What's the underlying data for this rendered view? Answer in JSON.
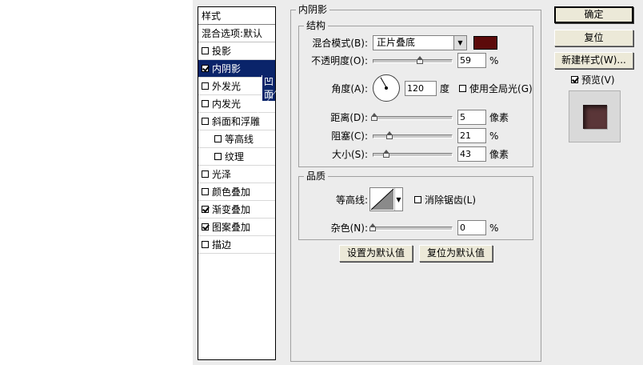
{
  "style_list": {
    "header": "样式",
    "blend_options": "混合选项:默认",
    "items": [
      {
        "label": "投影",
        "checked": false,
        "indent": false
      },
      {
        "label": "内阴影",
        "checked": true,
        "indent": false,
        "selected": true
      },
      {
        "label": "外发光",
        "checked": false,
        "indent": false
      },
      {
        "label": "内发光",
        "checked": false,
        "indent": false
      },
      {
        "label": "斜面和浮雕",
        "checked": false,
        "indent": false
      },
      {
        "label": "等高线",
        "checked": false,
        "indent": true
      },
      {
        "label": "纹理",
        "checked": false,
        "indent": true
      },
      {
        "label": "光泽",
        "checked": false,
        "indent": false
      },
      {
        "label": "颜色叠加",
        "checked": false,
        "indent": false
      },
      {
        "label": "渐变叠加",
        "checked": true,
        "indent": false
      },
      {
        "label": "图案叠加",
        "checked": true,
        "indent": false
      },
      {
        "label": "描边",
        "checked": false,
        "indent": false
      }
    ],
    "tooltip": "凹面"
  },
  "inner_shadow": {
    "title": "内阴影",
    "structure": {
      "title": "结构",
      "blend_mode_label": "混合模式(B):",
      "blend_mode_value": "正片叠底",
      "color": "#5c0a0a",
      "opacity_label": "不透明度(O):",
      "opacity_value": "59",
      "opacity_unit": "%",
      "opacity_fraction": 0.59,
      "angle_label": "角度(A):",
      "angle_value": "120",
      "angle_unit": "度",
      "global_light_label": "使用全局光(G)",
      "global_light_checked": false,
      "distance_label": "距离(D):",
      "distance_value": "5",
      "distance_unit": "像素",
      "distance_fraction": 0.02,
      "choke_label": "阻塞(C):",
      "choke_value": "21",
      "choke_unit": "%",
      "choke_fraction": 0.21,
      "size_label": "大小(S):",
      "size_value": "43",
      "size_unit": "像素",
      "size_fraction": 0.17
    },
    "quality": {
      "title": "品质",
      "contour_label": "等高线:",
      "anti_alias_label": "消除锯齿(L)",
      "anti_alias_checked": false,
      "noise_label": "杂色(N):",
      "noise_value": "0",
      "noise_unit": "%",
      "noise_fraction": 0.0
    },
    "make_default": "设置为默认值",
    "reset_default": "复位为默认值"
  },
  "buttons": {
    "ok": "确定",
    "reset": "复位",
    "new_style": "新建样式(W)...",
    "preview_label": "预览(V)",
    "preview_checked": true
  }
}
